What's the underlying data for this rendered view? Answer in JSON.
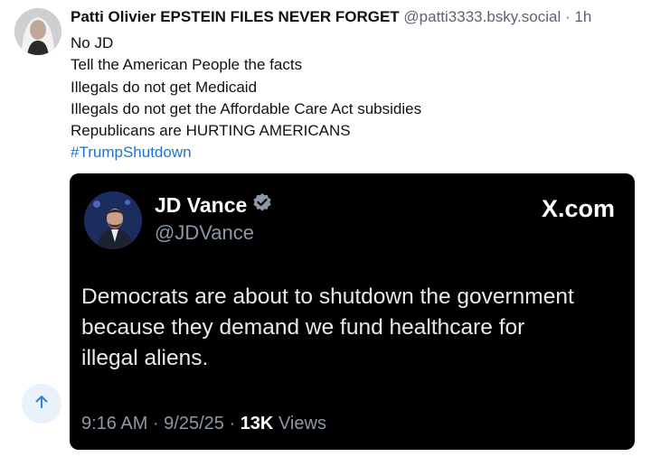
{
  "post": {
    "author_name": "Patti Olivier EPSTEIN FILES NEVER FORGET",
    "handle": "@patti3333.bsky.social",
    "time": "1h",
    "lines": [
      "No JD",
      "Tell the American People  the facts",
      "Illegals  do not get Medicaid",
      "Illegals  do not get the Affordable Care Act  subsidies",
      "Republicans are HURTING  AMERICANS"
    ],
    "hashtag": "#TrumpShutdown"
  },
  "embed": {
    "name": "JD Vance",
    "handle": "@JDVance",
    "source": "X.com",
    "text_lines": [
      "Democrats are about to shutdown the government",
      "because they demand we fund healthcare for",
      "illegal aliens."
    ],
    "time": "9:16 AM",
    "date": "9/25/25",
    "views_count": "13K",
    "views_label": "Views"
  },
  "colors": {
    "hashtag": "#1d72d8",
    "embed_bg": "#000000",
    "scroll_button_bg": "#e9f1fb",
    "scroll_arrow": "#2f7fe0"
  },
  "icons": {
    "verified": "verified-badge-icon",
    "scroll": "arrow-up-icon"
  }
}
